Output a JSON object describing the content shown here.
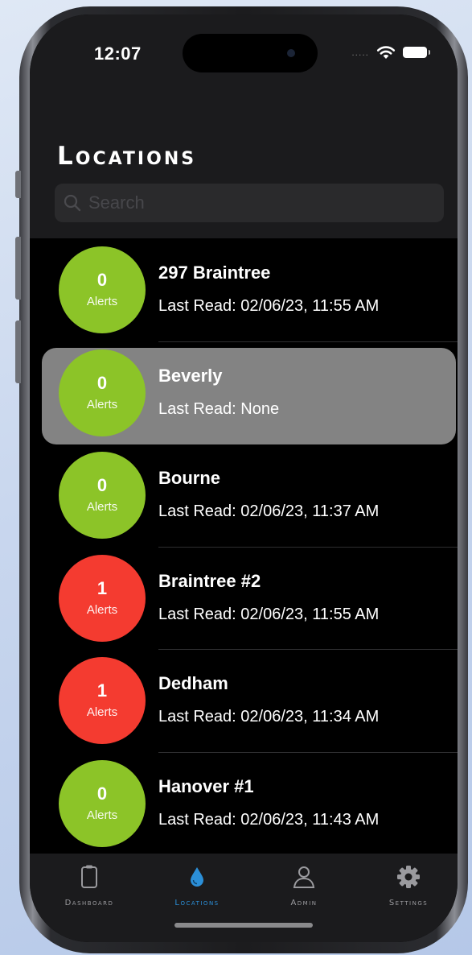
{
  "status_bar": {
    "time": "12:07",
    "signal": "....."
  },
  "header": {
    "title": "Locations"
  },
  "search": {
    "placeholder": "Search"
  },
  "locations": [
    {
      "name": "297 Braintree",
      "alerts": "0",
      "alerts_label": "Alerts",
      "last_read": "Last Read: 02/06/23, 11:55 AM",
      "status_color": "#8cc428"
    },
    {
      "name": "Beverly",
      "alerts": "0",
      "alerts_label": "Alerts",
      "last_read": "Last Read: None",
      "status_color": "#8cc428"
    },
    {
      "name": "Bourne",
      "alerts": "0",
      "alerts_label": "Alerts",
      "last_read": "Last Read: 02/06/23, 11:37 AM",
      "status_color": "#8cc428"
    },
    {
      "name": "Braintree #2",
      "alerts": "1",
      "alerts_label": "Alerts",
      "last_read": "Last Read: 02/06/23, 11:55 AM",
      "status_color": "#f43b30"
    },
    {
      "name": "Dedham",
      "alerts": "1",
      "alerts_label": "Alerts",
      "last_read": "Last Read: 02/06/23, 11:34 AM",
      "status_color": "#f43b30"
    },
    {
      "name": "Hanover #1",
      "alerts": "0",
      "alerts_label": "Alerts",
      "last_read": "Last Read: 02/06/23, 11:43 AM",
      "status_color": "#8cc428"
    }
  ],
  "tabs": [
    {
      "label": "Dashboard",
      "icon": "clipboard-icon"
    },
    {
      "label": "Locations",
      "icon": "water-drop-icon",
      "active": true
    },
    {
      "label": "Admin",
      "icon": "person-icon"
    },
    {
      "label": "Settings",
      "icon": "gear-icon"
    }
  ],
  "colors": {
    "ok": "#8cc428",
    "alert": "#f43b30",
    "accent": "#2b8fd8",
    "selected_row": "#838383"
  }
}
